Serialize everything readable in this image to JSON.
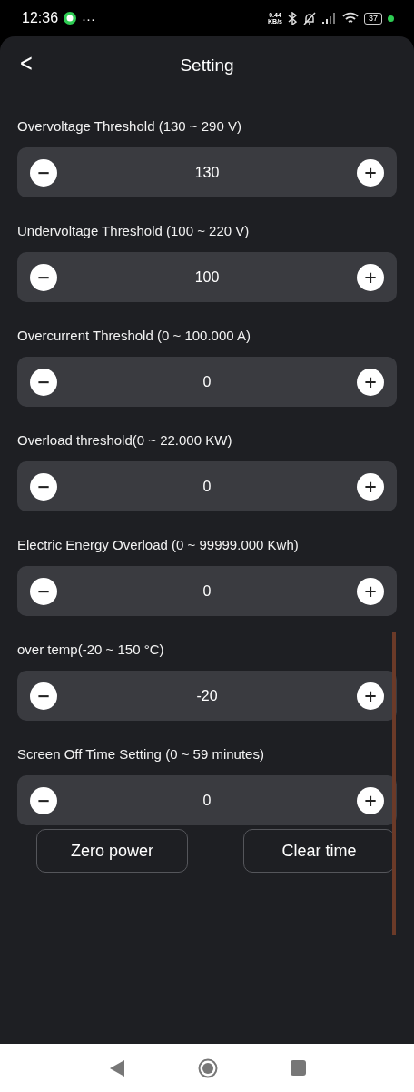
{
  "status_bar": {
    "time": "12:36",
    "more": "···",
    "net_speed": "0.44",
    "net_unit": "KB/s",
    "battery": "37"
  },
  "header": {
    "back": "<",
    "title": "Setting"
  },
  "settings": [
    {
      "label": "Overvoltage Threshold (130 ~ 290 V)",
      "value": "130",
      "minus": "−",
      "plus": "+"
    },
    {
      "label": "Undervoltage Threshold (100 ~ 220 V)",
      "value": "100",
      "minus": "−",
      "plus": "+"
    },
    {
      "label": "Overcurrent Threshold (0 ~ 100.000 A)",
      "value": "0",
      "minus": "−",
      "plus": "+"
    },
    {
      "label": "Overload threshold(0 ~ 22.000 KW)",
      "value": "0",
      "minus": "−",
      "plus": "+"
    },
    {
      "label": "Electric Energy Overload (0 ~ 99999.000 Kwh)",
      "value": "0",
      "minus": "−",
      "plus": "+"
    },
    {
      "label": "over temp(-20 ~ 150 °C)",
      "value": "-20",
      "minus": "−",
      "plus": "+"
    },
    {
      "label": "Screen Off Time Setting (0 ~ 59 minutes)",
      "value": "0",
      "minus": "−",
      "plus": "+"
    }
  ],
  "actions": [
    "Zero power",
    "Clear time"
  ]
}
